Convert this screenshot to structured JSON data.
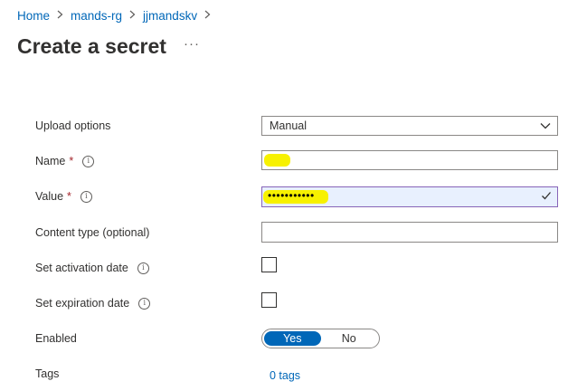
{
  "breadcrumb": {
    "items": [
      "Home",
      "mands-rg",
      "jjmandskv"
    ],
    "separator": ">"
  },
  "header": {
    "title": "Create a secret",
    "more_label": "···"
  },
  "form": {
    "upload_options": {
      "label": "Upload options",
      "value": "Manual"
    },
    "name": {
      "label": "Name",
      "required_mark": "*",
      "value": ""
    },
    "value": {
      "label": "Value",
      "required_mark": "*",
      "masked_value": "•••••••••••"
    },
    "content_type": {
      "label": "Content type (optional)",
      "value": ""
    },
    "activation_date": {
      "label": "Set activation date",
      "checked": false
    },
    "expiration_date": {
      "label": "Set expiration date",
      "checked": false
    },
    "enabled": {
      "label": "Enabled",
      "options": [
        "Yes",
        "No"
      ],
      "selected": "Yes"
    },
    "tags": {
      "label": "Tags",
      "link": "0 tags"
    }
  },
  "colors": {
    "accent": "#0067b8",
    "required": "#a4262c",
    "highlight": "#f7f100",
    "value_border": "#8764b8",
    "value_fill": "#e8f0fe"
  },
  "icons": {
    "info": "info-icon",
    "chevron": "chevron-down-icon",
    "valid": "checkmark-icon",
    "crumb_separator": "chevron-right-icon"
  }
}
